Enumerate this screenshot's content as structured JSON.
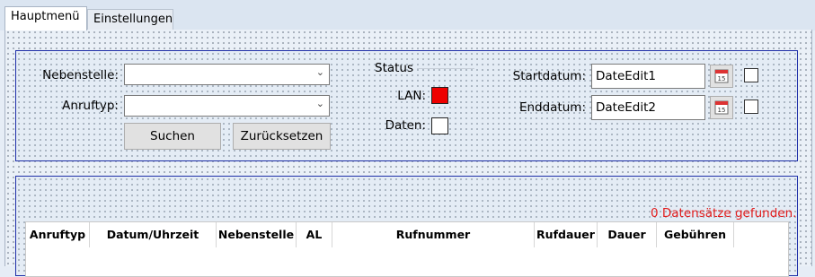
{
  "tabs": [
    {
      "label": "Hauptmenü",
      "active": true
    },
    {
      "label": "Einstellungen",
      "active": false
    }
  ],
  "filter": {
    "nebenstelle_label": "Nebenstelle:",
    "nebenstelle_value": "",
    "anruftyp_label": "Anruftyp:",
    "anruftyp_value": "",
    "search_label": "Suchen",
    "reset_label": "Zurücksetzen"
  },
  "status": {
    "title": "Status",
    "lan_label": "LAN:",
    "lan_color": "#ee0000",
    "daten_label": "Daten:",
    "daten_color": "#ffffff"
  },
  "dates": {
    "start_label": "Startdatum:",
    "start_value": "DateEdit1",
    "end_label": "Enddatum:",
    "end_value": "DateEdit2",
    "calendar_day": "15",
    "start_checked": false,
    "end_checked": false
  },
  "results": {
    "count_text": "0 Datensätze gefunden.",
    "columns": [
      "Anruftyp",
      "Datum/Uhrzeit",
      "Nebenstelle",
      "AL",
      "Rufnummer",
      "Rufdauer",
      "Dauer",
      "Gebühren"
    ],
    "rows": []
  }
}
